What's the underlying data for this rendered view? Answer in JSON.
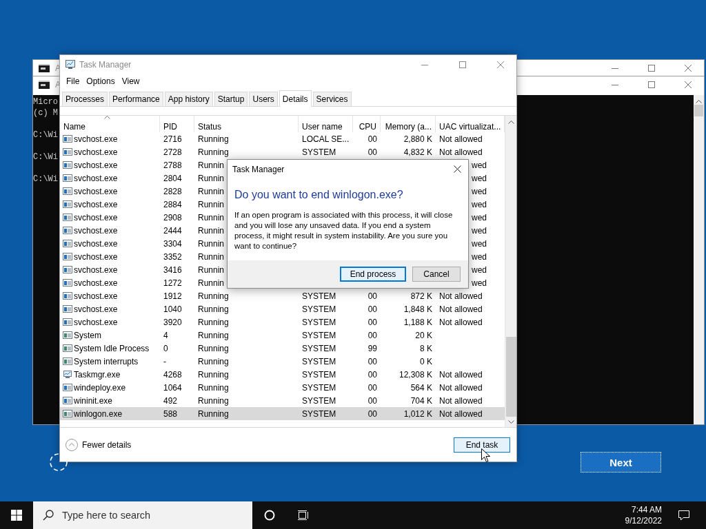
{
  "console_windows": [
    {
      "title": "A"
    },
    {
      "title": "A",
      "lines": [
        "Micro",
        "(c) M",
        "C:\\Wi",
        "C:\\Wi",
        "C:\\Wi"
      ]
    }
  ],
  "task_manager": {
    "title": "Task Manager",
    "menu": [
      "File",
      "Options",
      "View"
    ],
    "tabs": [
      {
        "label": "Processes",
        "selected": false
      },
      {
        "label": "Performance",
        "selected": false
      },
      {
        "label": "App history",
        "selected": false
      },
      {
        "label": "Startup",
        "selected": false
      },
      {
        "label": "Users",
        "selected": false
      },
      {
        "label": "Details",
        "selected": true
      },
      {
        "label": "Services",
        "selected": false
      }
    ],
    "columns": [
      {
        "label": "Name"
      },
      {
        "label": "PID"
      },
      {
        "label": "Status"
      },
      {
        "label": "User name"
      },
      {
        "label": "CPU"
      },
      {
        "label": "Memory (a..."
      },
      {
        "label": "UAC virtualizat..."
      }
    ],
    "rows": [
      {
        "kind": "service",
        "name": "svchost.exe",
        "pid": "2716",
        "status": "Running",
        "user": "LOCAL SE...",
        "cpu": "00",
        "memory": "2,880 K",
        "uac": "Not allowed",
        "selected": false
      },
      {
        "kind": "service",
        "name": "svchost.exe",
        "pid": "2728",
        "status": "Running",
        "user": "SYSTEM",
        "cpu": "00",
        "memory": "4,832 K",
        "uac": "Not allowed",
        "selected": false
      },
      {
        "kind": "service",
        "name": "svchost.exe",
        "pid": "2788",
        "status": "Runnin",
        "uac": "wed",
        "selected": false
      },
      {
        "kind": "service",
        "name": "svchost.exe",
        "pid": "2804",
        "status": "Runnin",
        "uac": "wed",
        "selected": false
      },
      {
        "kind": "service",
        "name": "svchost.exe",
        "pid": "2828",
        "status": "Runnin",
        "uac": "wed",
        "selected": false
      },
      {
        "kind": "service",
        "name": "svchost.exe",
        "pid": "2884",
        "status": "Runnin",
        "uac": "wed",
        "selected": false
      },
      {
        "kind": "service",
        "name": "svchost.exe",
        "pid": "2908",
        "status": "Runnin",
        "uac": "wed",
        "selected": false
      },
      {
        "kind": "service",
        "name": "svchost.exe",
        "pid": "2444",
        "status": "Runnin",
        "uac": "wed",
        "selected": false
      },
      {
        "kind": "service",
        "name": "svchost.exe",
        "pid": "3304",
        "status": "Runnin",
        "uac": "wed",
        "selected": false
      },
      {
        "kind": "service",
        "name": "svchost.exe",
        "pid": "3352",
        "status": "Runnin",
        "uac": "wed",
        "selected": false
      },
      {
        "kind": "service",
        "name": "svchost.exe",
        "pid": "3416",
        "status": "Runnin",
        "uac": "wed",
        "selected": false
      },
      {
        "kind": "service",
        "name": "svchost.exe",
        "pid": "1272",
        "status": "Runnin",
        "uac": "wed",
        "selected": false
      },
      {
        "kind": "service",
        "name": "svchost.exe",
        "pid": "1912",
        "status": "Running",
        "user": "SYSTEM",
        "cpu": "00",
        "memory": "872 K",
        "uac": "Not allowed",
        "selected": false
      },
      {
        "kind": "service",
        "name": "svchost.exe",
        "pid": "1040",
        "status": "Running",
        "user": "SYSTEM",
        "cpu": "00",
        "memory": "1,848 K",
        "uac": "Not allowed",
        "selected": false
      },
      {
        "kind": "service",
        "name": "svchost.exe",
        "pid": "3920",
        "status": "Running",
        "user": "SYSTEM",
        "cpu": "00",
        "memory": "1,188 K",
        "uac": "Not allowed",
        "selected": false
      },
      {
        "kind": "system",
        "name": "System",
        "pid": "4",
        "status": "Running",
        "user": "SYSTEM",
        "cpu": "00",
        "memory": "20 K",
        "selected": false
      },
      {
        "kind": "system",
        "name": "System Idle Process",
        "pid": "0",
        "status": "Running",
        "user": "SYSTEM",
        "cpu": "99",
        "memory": "8 K",
        "selected": false
      },
      {
        "kind": "system",
        "name": "System interrupts",
        "pid": "-",
        "status": "Running",
        "user": "SYSTEM",
        "cpu": "00",
        "memory": "0 K",
        "selected": false
      },
      {
        "kind": "taskmgr",
        "name": "Taskmgr.exe",
        "pid": "4268",
        "status": "Running",
        "user": "SYSTEM",
        "cpu": "00",
        "memory": "12,308 K",
        "uac": "Not allowed",
        "selected": false
      },
      {
        "kind": "service",
        "name": "windeploy.exe",
        "pid": "1064",
        "status": "Running",
        "user": "SYSTEM",
        "cpu": "00",
        "memory": "564 K",
        "uac": "Not allowed",
        "selected": false
      },
      {
        "kind": "service",
        "name": "wininit.exe",
        "pid": "492",
        "status": "Running",
        "user": "SYSTEM",
        "cpu": "00",
        "memory": "704 K",
        "uac": "Not allowed",
        "selected": false
      },
      {
        "kind": "system",
        "name": "winlogon.exe",
        "pid": "588",
        "status": "Running",
        "user": "SYSTEM",
        "cpu": "00",
        "memory": "1,012 K",
        "uac": "Not allowed",
        "selected": true
      }
    ],
    "fewer_details": "Fewer details",
    "end_task": "End task"
  },
  "dialog": {
    "title": "Task Manager",
    "heading": "Do you want to end winlogon.exe?",
    "message": "If an open program is associated with this process, it will close and you will lose any unsaved data. If you end a system process, it might result in system instability. Are you sure you want to continue?",
    "buttons": [
      {
        "label": "End process",
        "default": true
      },
      {
        "label": "Cancel",
        "default": false
      }
    ]
  },
  "setup": {
    "next_button": "Next"
  },
  "taskbar": {
    "search_placeholder": "Type here to search",
    "time": "7:44 AM",
    "date": "9/12/2022"
  }
}
